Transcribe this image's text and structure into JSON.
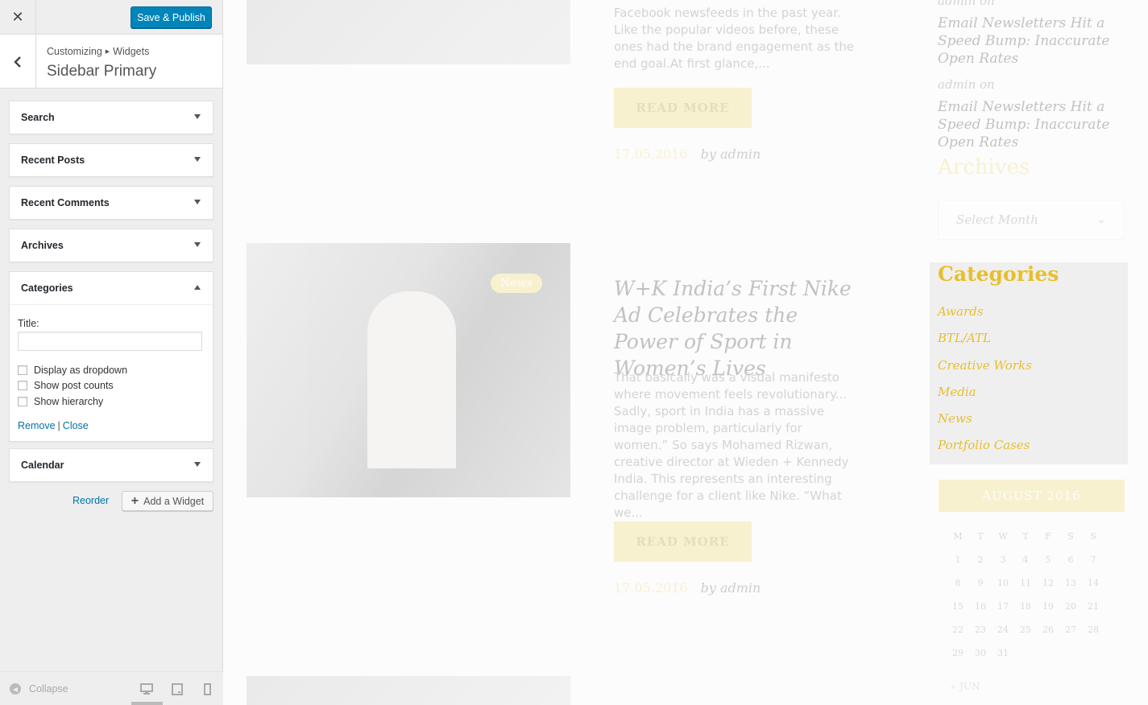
{
  "customizer": {
    "close_icon": "close-icon",
    "publish_label": "Save & Publish",
    "breadcrumb": {
      "root": "Customizing",
      "current": "Widgets"
    },
    "section_title": "Sidebar Primary",
    "widgets": [
      {
        "label": "Search"
      },
      {
        "label": "Recent Posts"
      },
      {
        "label": "Recent Comments"
      },
      {
        "label": "Archives"
      },
      {
        "label": "Categories",
        "expanded": true
      },
      {
        "label": "Calendar"
      }
    ],
    "categories_form": {
      "title_label": "Title:",
      "title_value": "",
      "options": [
        {
          "label": "Display as dropdown",
          "checked": false
        },
        {
          "label": "Show post counts",
          "checked": false
        },
        {
          "label": "Show hierarchy",
          "checked": false
        }
      ],
      "remove_label": "Remove",
      "close_label": "Close",
      "separator": "|"
    },
    "reorder_label": "Reorder",
    "add_widget_label": "Add a Widget",
    "footer": {
      "collapse_label": "Collapse",
      "preview_device": "desktop"
    },
    "accent_color": "#0085ba"
  },
  "preview": {
    "post1": {
      "excerpt": "Facebook newsfeeds in the past year. Like the popular videos before, these ones had the brand engagement as the end goal.At first glance,...",
      "read_more": "READ MORE",
      "date": "17.05.2016",
      "by": "by admin"
    },
    "post2": {
      "badge": "News",
      "title": "W+K India’s First Nike Ad Celebrates the Power of Sport in Women’s Lives",
      "excerpt": "That basically was a visual manifesto where movement feels revolutionary... Sadly, sport in India has a massive image problem, particularly for women.” So says Mohamed Rizwan, creative director at Wieden + Kennedy India. This represents an interesting challenge for a client like Nike. “What we...",
      "read_more": "READ MORE",
      "date": "17.05.2016",
      "by": "by admin"
    },
    "sidebar": {
      "comment1": {
        "meta": "admin on",
        "link": "Email Newsletters Hit a Speed Bump: Inaccurate Open Rates"
      },
      "comment2": {
        "meta": "admin on",
        "link": "Email Newsletters Hit a Speed Bump: Inaccurate Open Rates"
      },
      "archives_title": "Archives",
      "select_month": "Select Month",
      "categories_title": "Categories",
      "categories": [
        "Awards",
        "BTL/ATL",
        "Creative Works",
        "Media",
        "News",
        "Portfolio Cases"
      ],
      "calendar": {
        "month": "AUGUST 2016",
        "weekdays": [
          "M",
          "T",
          "W",
          "T",
          "F",
          "S",
          "S"
        ],
        "weeks": [
          [
            "1",
            "2",
            "3",
            "4",
            "5",
            "6",
            "7"
          ],
          [
            "8",
            "9",
            "10",
            "11",
            "12",
            "13",
            "14"
          ],
          [
            "15",
            "16",
            "17",
            "18",
            "19",
            "20",
            "21"
          ],
          [
            "22",
            "23",
            "24",
            "25",
            "26",
            "27",
            "28"
          ],
          [
            "29",
            "30",
            "31",
            "",
            "",
            "",
            ""
          ]
        ],
        "prev_label": "« JUN"
      },
      "brand_color": "#e8bf2b"
    }
  }
}
